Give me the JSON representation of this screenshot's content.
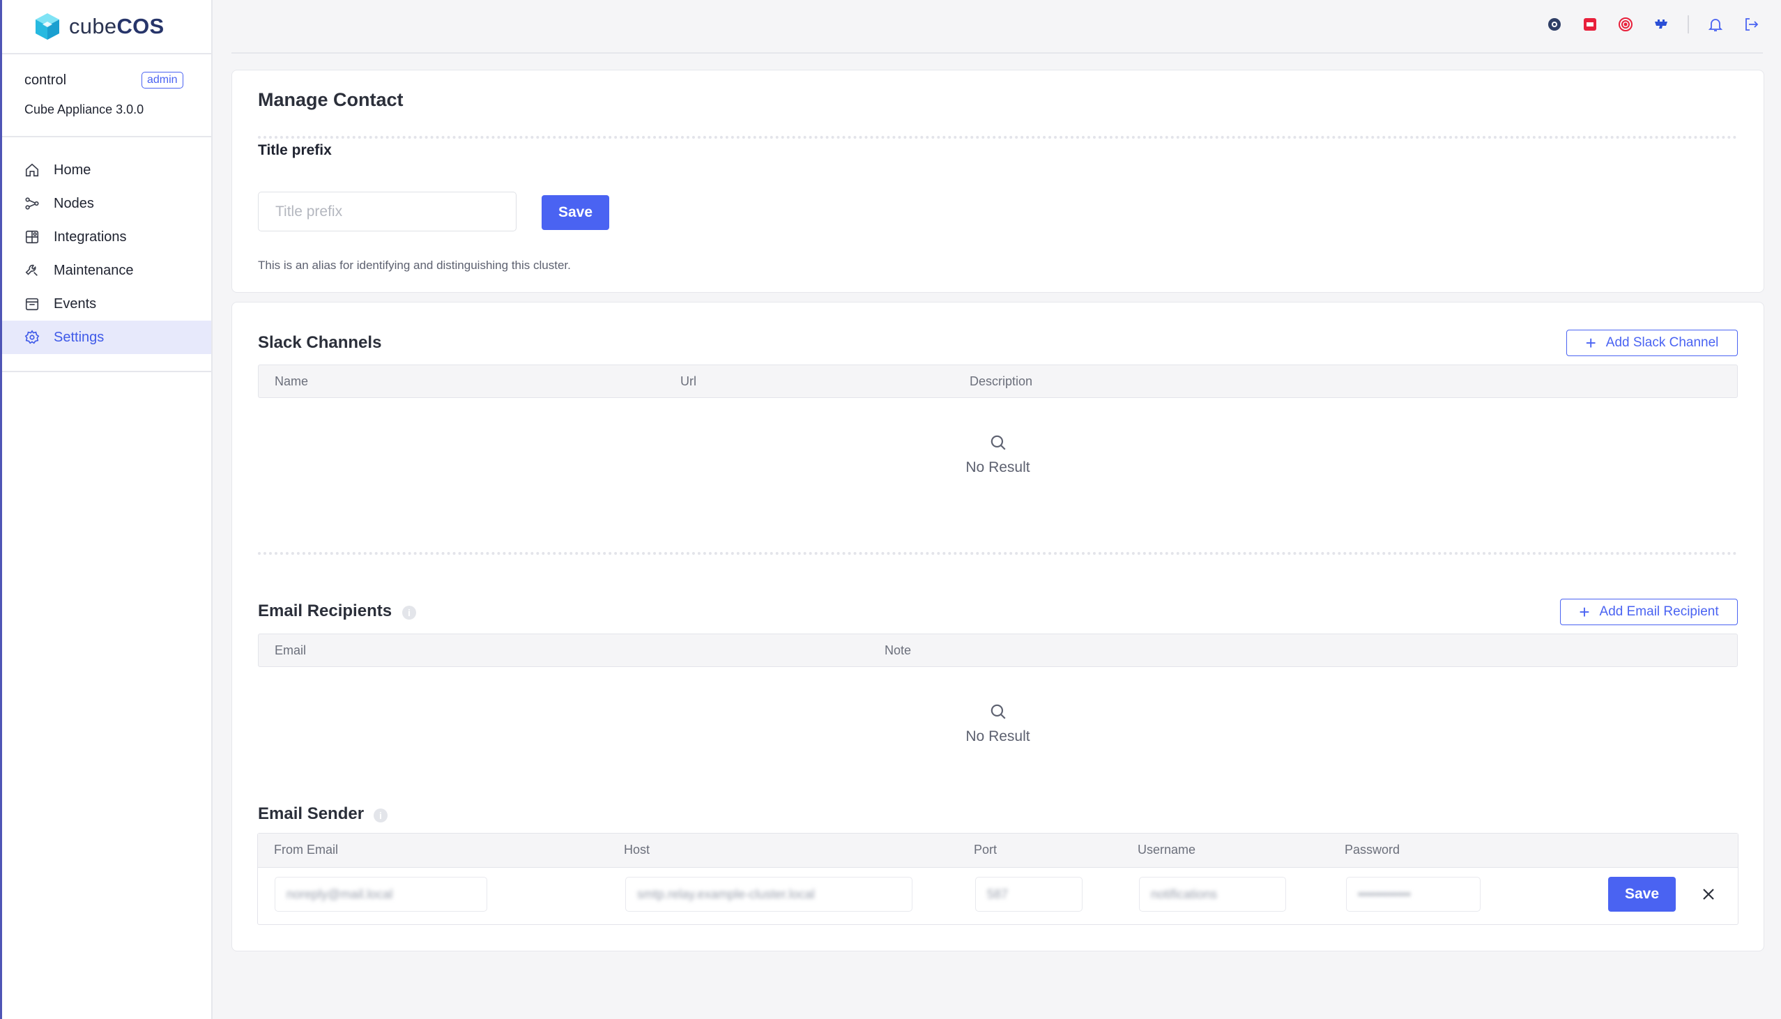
{
  "app": {
    "brand_light": "cube",
    "brand_bold": "COS",
    "accent_color": "#4a63f2"
  },
  "sidebar": {
    "user": "control",
    "role_badge": "admin",
    "appliance": "Cube Appliance 3.0.0",
    "items": [
      {
        "label": "Home",
        "icon": "home-icon"
      },
      {
        "label": "Nodes",
        "icon": "nodes-icon"
      },
      {
        "label": "Integrations",
        "icon": "integrations-icon"
      },
      {
        "label": "Maintenance",
        "icon": "maintenance-icon"
      },
      {
        "label": "Events",
        "icon": "events-icon"
      },
      {
        "label": "Settings",
        "icon": "settings-icon",
        "active": true
      }
    ]
  },
  "topbar": {
    "icons": [
      "ceph-icon",
      "openstack-icon",
      "grafana-icon",
      "kubernetes-icon",
      "bell-icon",
      "logout-icon"
    ]
  },
  "manage_contact": {
    "title": "Manage Contact",
    "title_prefix_label": "Title prefix",
    "title_prefix_placeholder": "Title prefix",
    "title_prefix_value": "",
    "save_label": "Save",
    "help_text": "This is an alias for identifying and distinguishing this cluster."
  },
  "slack": {
    "title": "Slack Channels",
    "add_label": "Add Slack Channel",
    "columns": [
      "Name",
      "Url",
      "Description"
    ],
    "rows": [],
    "empty_text": "No Result"
  },
  "email_recipients": {
    "title": "Email Recipients",
    "add_label": "Add Email Recipient",
    "columns": [
      "Email",
      "Note"
    ],
    "rows": [],
    "empty_text": "No Result"
  },
  "email_sender": {
    "title": "Email Sender",
    "columns": [
      "From Email",
      "Host",
      "Port",
      "Username",
      "Password"
    ],
    "values": {
      "from_email": "noreply@mail.local",
      "host": "smtp.relay.example-cluster.local",
      "port": "587",
      "username": "notifications",
      "password": "••••••••••••"
    },
    "save_label": "Save"
  }
}
